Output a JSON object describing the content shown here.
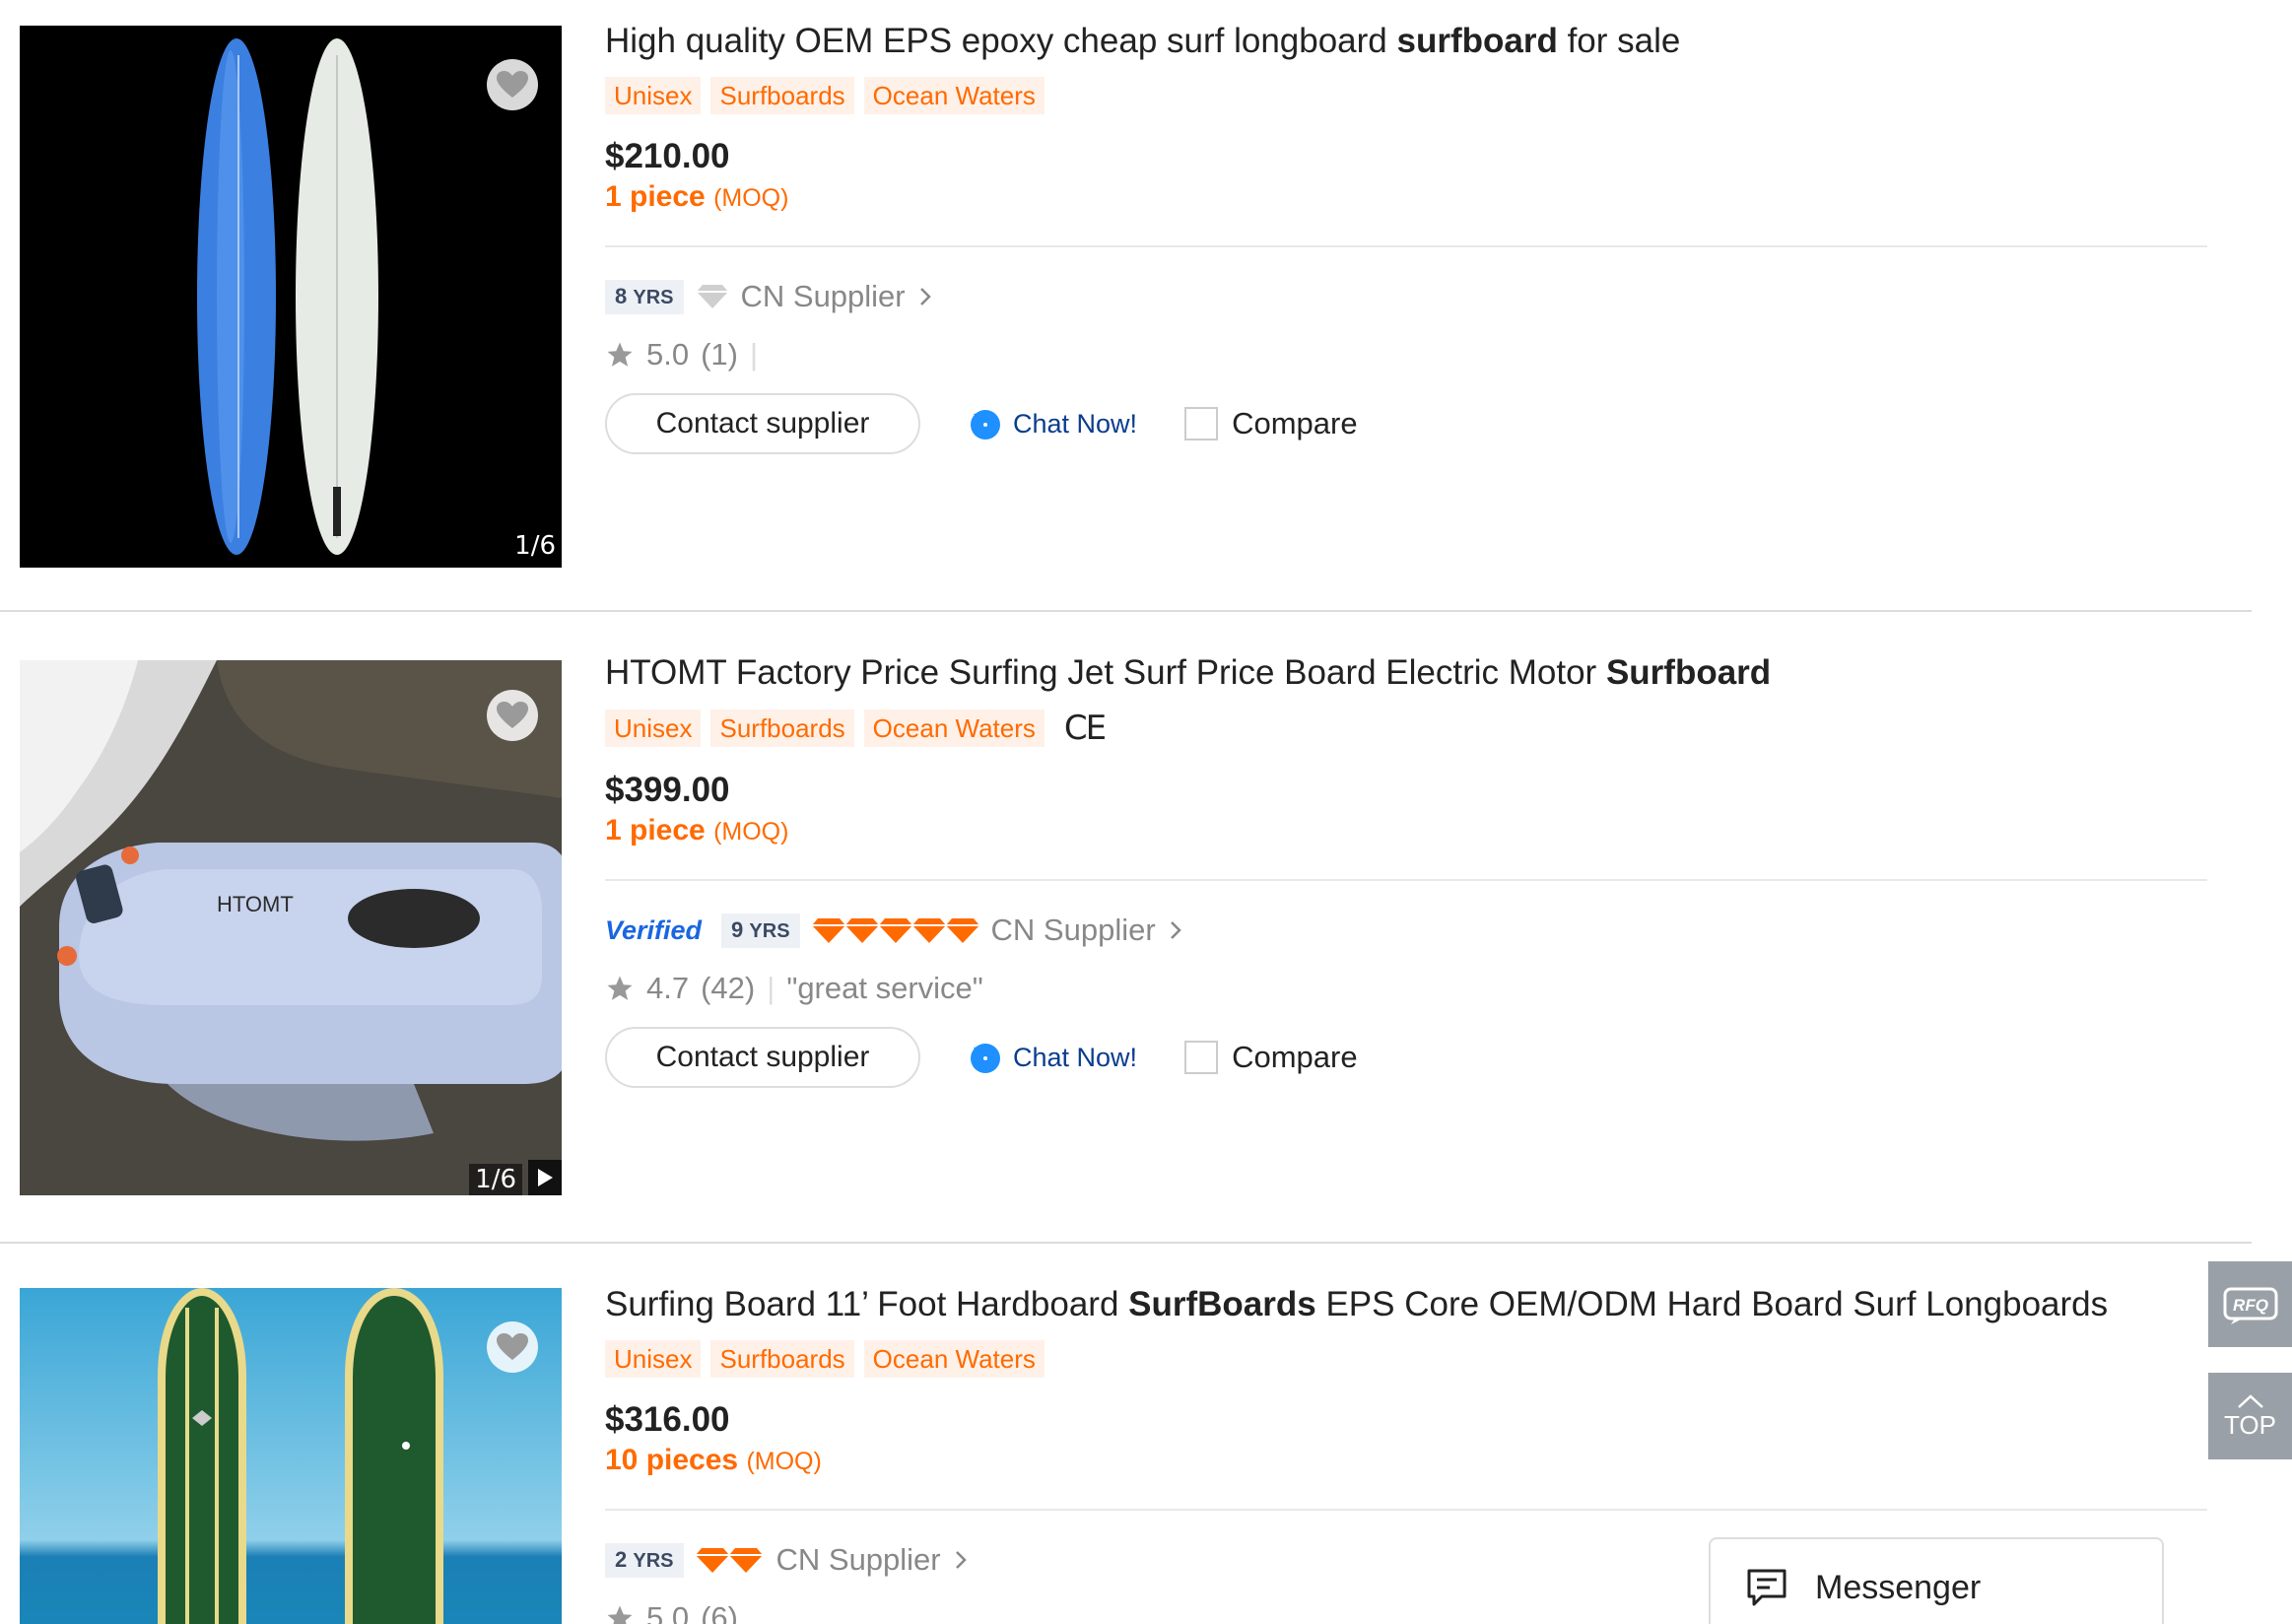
{
  "listings": [
    {
      "title_pre": "High quality OEM EPS epoxy cheap surf longboard ",
      "title_bold": "surfboard",
      "title_post": " for sale",
      "tags": [
        "Unisex",
        "Surfboards",
        "Ocean Waters"
      ],
      "price": "$210.00",
      "moq_qty": "1 piece",
      "moq_label": "(MOQ)",
      "verified": "",
      "years_num": "8",
      "years_unit": "YRS",
      "country": "CN Supplier",
      "rating": "5.0",
      "reviews": "(1)",
      "review_quote": "",
      "image_counter": "1/6",
      "contact_label": "Contact supplier",
      "chat_label": "Chat Now!",
      "compare_label": "Compare"
    },
    {
      "title_pre": "HTOMT Factory Price Surfing Jet Surf Price Board Electric Motor ",
      "title_bold": "Surfboard",
      "title_post": "",
      "tags": [
        "Unisex",
        "Surfboards",
        "Ocean Waters"
      ],
      "cert": "CE",
      "price": "$399.00",
      "moq_qty": "1 piece",
      "moq_label": "(MOQ)",
      "verified": "Verified",
      "years_num": "9",
      "years_unit": "YRS",
      "country": "CN Supplier",
      "rating": "4.7",
      "reviews": "(42)",
      "review_quote": "\"great service\"",
      "image_counter": "1/6",
      "image_brand_text": "HTOMT",
      "contact_label": "Contact supplier",
      "chat_label": "Chat Now!",
      "compare_label": "Compare"
    },
    {
      "title_pre": "Surfing Board 11’ Foot Hardboard ",
      "title_bold": "SurfBoards",
      "title_post": " EPS Core OEM/ODM Hard Board Surf Longboards",
      "tags": [
        "Unisex",
        "Surfboards",
        "Ocean Waters"
      ],
      "price": "$316.00",
      "moq_qty": "10 pieces",
      "moq_label": "(MOQ)",
      "years_num": "2",
      "years_unit": "YRS",
      "country": "CN Supplier",
      "rating": "5.0",
      "reviews": "(6)"
    }
  ],
  "sidebar": {
    "rfq_label": "RFQ",
    "top_label": "TOP"
  },
  "messenger": {
    "label": "Messenger"
  },
  "colors": {
    "accent_orange": "#ff6a00",
    "verified_blue": "#1a66e0",
    "chat_blue": "#1e90ff",
    "side_gray": "#9aa0a7"
  }
}
